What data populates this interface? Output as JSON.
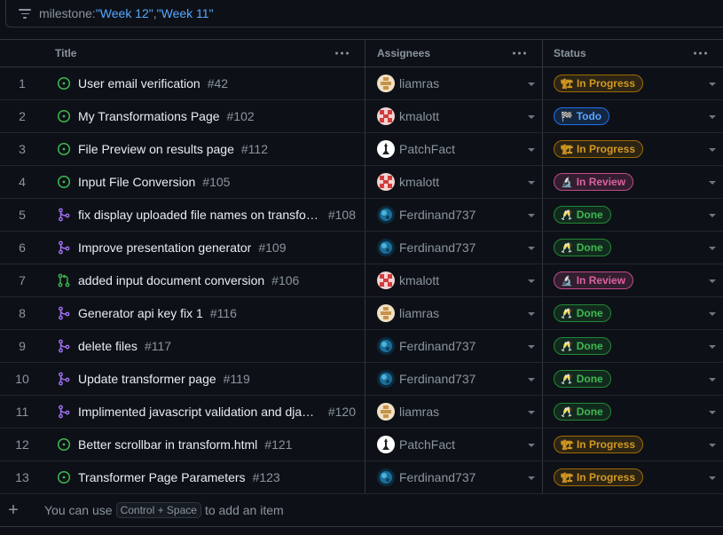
{
  "filter": {
    "prefix": "milestone:",
    "value1": "\"Week 12\"",
    "separator": ",",
    "value2": "\"Week 11\""
  },
  "columns": {
    "title": "Title",
    "assignees": "Assignees",
    "status": "Status"
  },
  "status_colors": {
    "In Progress": "#d29922",
    "Todo": "#58a6ff",
    "In Review": "#db61a2",
    "Done": "#3fb950"
  },
  "rows": [
    {
      "n": "1",
      "type": "issue-open",
      "title": "User email verification",
      "num": "#42",
      "assignee": "liamras",
      "status": "In Progress",
      "status_class": "b-progress",
      "status_emoji": "🏗"
    },
    {
      "n": "2",
      "type": "issue-open",
      "title": "My Transformations Page",
      "num": "#102",
      "assignee": "kmalott",
      "status": "Todo",
      "status_class": "b-todo",
      "status_emoji": "🏁"
    },
    {
      "n": "3",
      "type": "issue-open",
      "title": "File Preview on results page",
      "num": "#112",
      "assignee": "PatchFact",
      "status": "In Progress",
      "status_class": "b-progress",
      "status_emoji": "🏗"
    },
    {
      "n": "4",
      "type": "issue-open",
      "title": "Input File Conversion",
      "num": "#105",
      "assignee": "kmalott",
      "status": "In Review",
      "status_class": "b-review",
      "status_emoji": "🔬"
    },
    {
      "n": "5",
      "type": "pr-merged",
      "title": "fix display uploaded file names on transfo…",
      "num": "#108",
      "assignee": "Ferdinand737",
      "status": "Done",
      "status_class": "b-done",
      "status_emoji": "🥂"
    },
    {
      "n": "6",
      "type": "pr-merged",
      "title": "Improve presentation generator",
      "num": "#109",
      "assignee": "Ferdinand737",
      "status": "Done",
      "status_class": "b-done",
      "status_emoji": "🥂"
    },
    {
      "n": "7",
      "type": "pr-open",
      "title": "added input document conversion",
      "num": "#106",
      "assignee": "kmalott",
      "status": "In Review",
      "status_class": "b-review",
      "status_emoji": "🔬"
    },
    {
      "n": "8",
      "type": "pr-merged",
      "title": "Generator api key fix 1",
      "num": "#116",
      "assignee": "liamras",
      "status": "Done",
      "status_class": "b-done",
      "status_emoji": "🥂"
    },
    {
      "n": "9",
      "type": "pr-merged",
      "title": "delete files",
      "num": "#117",
      "assignee": "Ferdinand737",
      "status": "Done",
      "status_class": "b-done",
      "status_emoji": "🥂"
    },
    {
      "n": "10",
      "type": "pr-merged",
      "title": "Update transformer page",
      "num": "#119",
      "assignee": "Ferdinand737",
      "status": "Done",
      "status_class": "b-done",
      "status_emoji": "🥂"
    },
    {
      "n": "11",
      "type": "pr-merged",
      "title": "Implimented javascript validation and djan…",
      "num": "#120",
      "assignee": "liamras",
      "status": "Done",
      "status_class": "b-done",
      "status_emoji": "🥂"
    },
    {
      "n": "12",
      "type": "issue-open",
      "title": "Better scrollbar in transform.html",
      "num": "#121",
      "assignee": "PatchFact",
      "status": "In Progress",
      "status_class": "b-progress",
      "status_emoji": "🏗"
    },
    {
      "n": "13",
      "type": "issue-open",
      "title": "Transformer Page Parameters",
      "num": "#123",
      "assignee": "Ferdinand737",
      "status": "In Progress",
      "status_class": "b-progress",
      "status_emoji": "🏗"
    }
  ],
  "footer": {
    "plus": "+",
    "before": "You can use",
    "shortcut": "Control + Space",
    "after": "to add an item"
  }
}
